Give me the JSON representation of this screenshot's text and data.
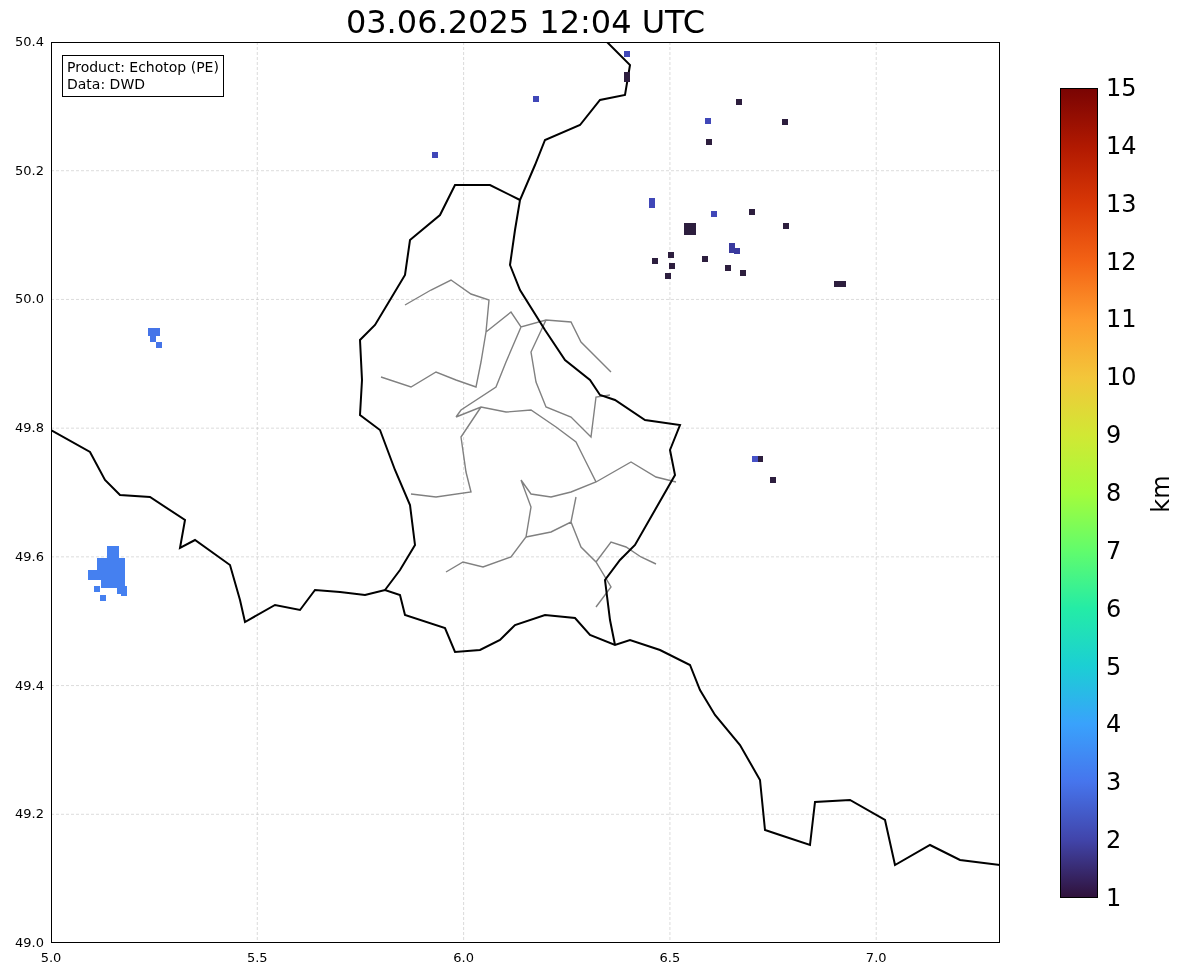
{
  "title": "03.06.2025 12:04 UTC",
  "legend": {
    "lines": [
      "Product: Echotop (PE)",
      "Data: DWD"
    ]
  },
  "x_ticks": [
    "5.0",
    "5.5",
    "6.0",
    "6.5",
    "7.0"
  ],
  "y_ticks": [
    "50.4",
    "50.2",
    "50.0",
    "49.8",
    "49.6",
    "49.4",
    "49.2",
    "49.0"
  ],
  "colorbar": {
    "label": "km",
    "ticks": [
      "15",
      "14",
      "13",
      "12",
      "11",
      "10",
      "9",
      "8",
      "7",
      "6",
      "5",
      "4",
      "3",
      "2",
      "1"
    ]
  }
}
